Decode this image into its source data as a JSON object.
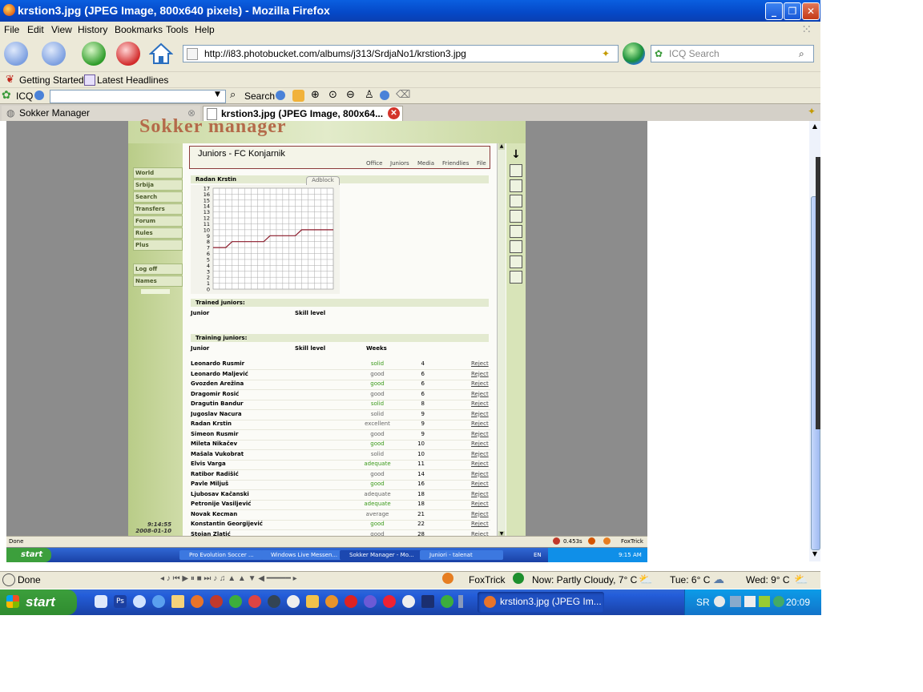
{
  "window": {
    "title": "krstion3.jpg (JPEG Image, 800x640 pixels) - Mozilla Firefox"
  },
  "menu": [
    "File",
    "Edit",
    "View",
    "History",
    "Bookmarks",
    "Tools",
    "Help"
  ],
  "address": {
    "url": "http://i83.photobucket.com/albums/j313/SrdjaNo1/krstion3.jpg"
  },
  "search": {
    "placeholder": "ICQ Search"
  },
  "bookmarks": [
    "Getting Started",
    "Latest Headlines"
  ],
  "icqbar": {
    "label": "ICQ",
    "search_label": "Search"
  },
  "tabs": [
    {
      "label": "Sokker Manager"
    },
    {
      "label": "krstion3.jpg (JPEG Image, 800x64..."
    }
  ],
  "inner": {
    "logo": "Sokker manager",
    "page_title": "Juniors - FC Konjarnik",
    "top_nav": [
      "Office",
      "Juniors",
      "Media",
      "Friendlies",
      "File"
    ],
    "side_nav": [
      "World",
      "Srbija",
      "Search",
      "Transfers",
      "Forum",
      "Rules",
      "Plus"
    ],
    "side_nav2": [
      "Log off",
      "Names"
    ],
    "clock": {
      "time": "9:14:55",
      "date": "2008-01-10"
    },
    "graph": {
      "player": "Radan Krstin",
      "adblock": "Adblock",
      "y_ticks": [
        "17",
        "16",
        "15",
        "14",
        "13",
        "12",
        "11",
        "10",
        "9",
        "8",
        "7",
        "6",
        "5",
        "4",
        "3",
        "2",
        "1",
        "0"
      ]
    },
    "trained": {
      "heading": "Trained juniors:",
      "col_junior": "Junior",
      "col_skill": "Skill level"
    },
    "training": {
      "heading": "Training juniors:",
      "col_junior": "Junior",
      "col_skill": "Skill level",
      "col_weeks": "Weeks",
      "rows": [
        {
          "name": "Leonardo Rusmir",
          "skill": "solid",
          "weeks": "4",
          "action": "Reject"
        },
        {
          "name": "Leonardo Maljević",
          "skill": "good",
          "weeks": "6",
          "action": "Reject"
        },
        {
          "name": "Gvozden Arežina",
          "skill": "good",
          "weeks": "6",
          "action": "Reject"
        },
        {
          "name": "Dragomir Rosić",
          "skill": "good",
          "weeks": "6",
          "action": "Reject"
        },
        {
          "name": "Dragutin Bandur",
          "skill": "solid",
          "weeks": "8",
          "action": "Reject"
        },
        {
          "name": "Jugoslav Nacura",
          "skill": "solid",
          "weeks": "9",
          "action": "Reject"
        },
        {
          "name": "Radan Krstin",
          "skill": "excellent",
          "weeks": "9",
          "action": "Reject"
        },
        {
          "name": "Simeon Rusmir",
          "skill": "good",
          "weeks": "9",
          "action": "Reject"
        },
        {
          "name": "Mileta Nikačev",
          "skill": "good",
          "weeks": "10",
          "action": "Reject"
        },
        {
          "name": "Mašala Vukobrat",
          "skill": "solid",
          "weeks": "10",
          "action": "Reject"
        },
        {
          "name": "Elvis Varga",
          "skill": "adequate",
          "weeks": "11",
          "action": "Reject"
        },
        {
          "name": "Ratibor Radišić",
          "skill": "good",
          "weeks": "14",
          "action": "Reject"
        },
        {
          "name": "Pavle Miljuš",
          "skill": "good",
          "weeks": "16",
          "action": "Reject"
        },
        {
          "name": "Ljubosav Kačanski",
          "skill": "adequate",
          "weeks": "18",
          "action": "Reject"
        },
        {
          "name": "Petronije Vasiljević",
          "skill": "adequate",
          "weeks": "18",
          "action": "Reject"
        },
        {
          "name": "Novak Kecman",
          "skill": "average",
          "weeks": "21",
          "action": "Reject"
        },
        {
          "name": "Konstantin Georgijević",
          "skill": "good",
          "weeks": "22",
          "action": "Reject"
        },
        {
          "name": "Stojan Zlatić",
          "skill": "good",
          "weeks": "28",
          "action": "Reject"
        }
      ]
    },
    "statusbar": {
      "left": "Done",
      "time": "0.453s",
      "foxtrick": "FoxTrick"
    },
    "taskbar": {
      "start": "start",
      "items": [
        "Pro Evolution Soccer ...",
        "Windows Live Messen...",
        "Sokker Manager - Mo...",
        "Juniori - talenat"
      ],
      "lang": "EN",
      "clock": "9:15 AM"
    }
  },
  "statusbar": {
    "done": "Done",
    "foxtrick": "FoxTrick",
    "weather_now": "Now: Partly Cloudy, 7° C",
    "tue": "Tue: 6° C",
    "wed": "Wed: 9° C"
  },
  "taskbar": {
    "start": "start",
    "active_item": "krstion3.jpg (JPEG Im...",
    "lang": "SR",
    "clock": "20:09"
  },
  "chart_data": {
    "type": "line",
    "x": [
      1,
      2,
      3,
      4,
      5,
      6,
      7,
      8,
      9,
      10,
      11,
      12,
      13,
      14,
      15,
      16,
      17,
      18,
      19,
      20
    ],
    "y": [
      7,
      7,
      7,
      8,
      8,
      8,
      8,
      8,
      8,
      9,
      9,
      9,
      9,
      9,
      10,
      10,
      10,
      10,
      10,
      10
    ],
    "ylim": [
      0,
      17
    ]
  },
  "colors": {
    "sokker_green": "#d8e4b8",
    "graph_line": "#8b1a2a",
    "xp_blue": "#245edb"
  }
}
